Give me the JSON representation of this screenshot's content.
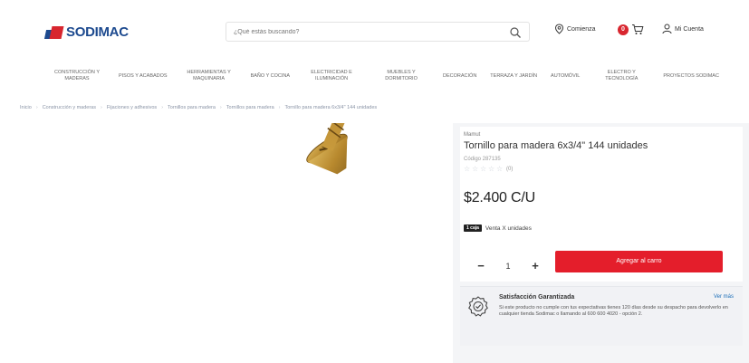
{
  "header": {
    "logo_text": "SODIMAC",
    "search": {
      "placeholder": "¿Qué estás buscando?"
    },
    "location_label": "Comienza",
    "cart_count": "0",
    "account_label": "Mi Cuenta"
  },
  "nav": {
    "items": [
      "CONSTRUCCIÓN Y MADERAS",
      "PISOS Y ACABADOS",
      "HERRAMIENTAS Y MAQUINARIA",
      "BAÑO Y COCINA",
      "ELECTRICIDAD E ILUMINACIÓN",
      "MUEBLES Y DORMITORIO",
      "DECORACIÓN",
      "TERRAZA Y JARDÍN",
      "AUTOMÓVIL",
      "ELECTRO Y TECNOLOGÍA",
      "PROYECTOS SODIMAC"
    ]
  },
  "breadcrumb": [
    "Inicio",
    "Construcción y maderas",
    "Fijaciones y adhesivos",
    "Tornillos para madera",
    "Tornillos para madera",
    "Tornillo para madera 6x3/4\" 144 unidades"
  ],
  "product": {
    "brand": "Mamut",
    "title": "Tornillo para madera 6x3/4\" 144 unidades",
    "sku": "Código 287135",
    "reviews": "(0)",
    "price": "$2.400 C/U",
    "unit_tag": "1 caja",
    "unit_text": "Venta X unidades",
    "quantity": "1",
    "add_button": "Agregar al carro"
  },
  "guarantee": {
    "title": "Satisfacción Garantizada",
    "link": "Ver más",
    "body": "Si este producto no cumple con tus expectativas tienes 120 días desde su despacho para devolverlo en cualquier tienda Sodimac o llamando al 600 600 4020 - opción 2."
  },
  "colors": {
    "brand_blue": "#1d4a8f",
    "brand_red": "#d8262f",
    "cta_red": "#e41e2b"
  },
  "icons": [
    "search-icon",
    "location-icon",
    "cart-icon",
    "user-icon",
    "guarantee-icon",
    "star-icon"
  ]
}
